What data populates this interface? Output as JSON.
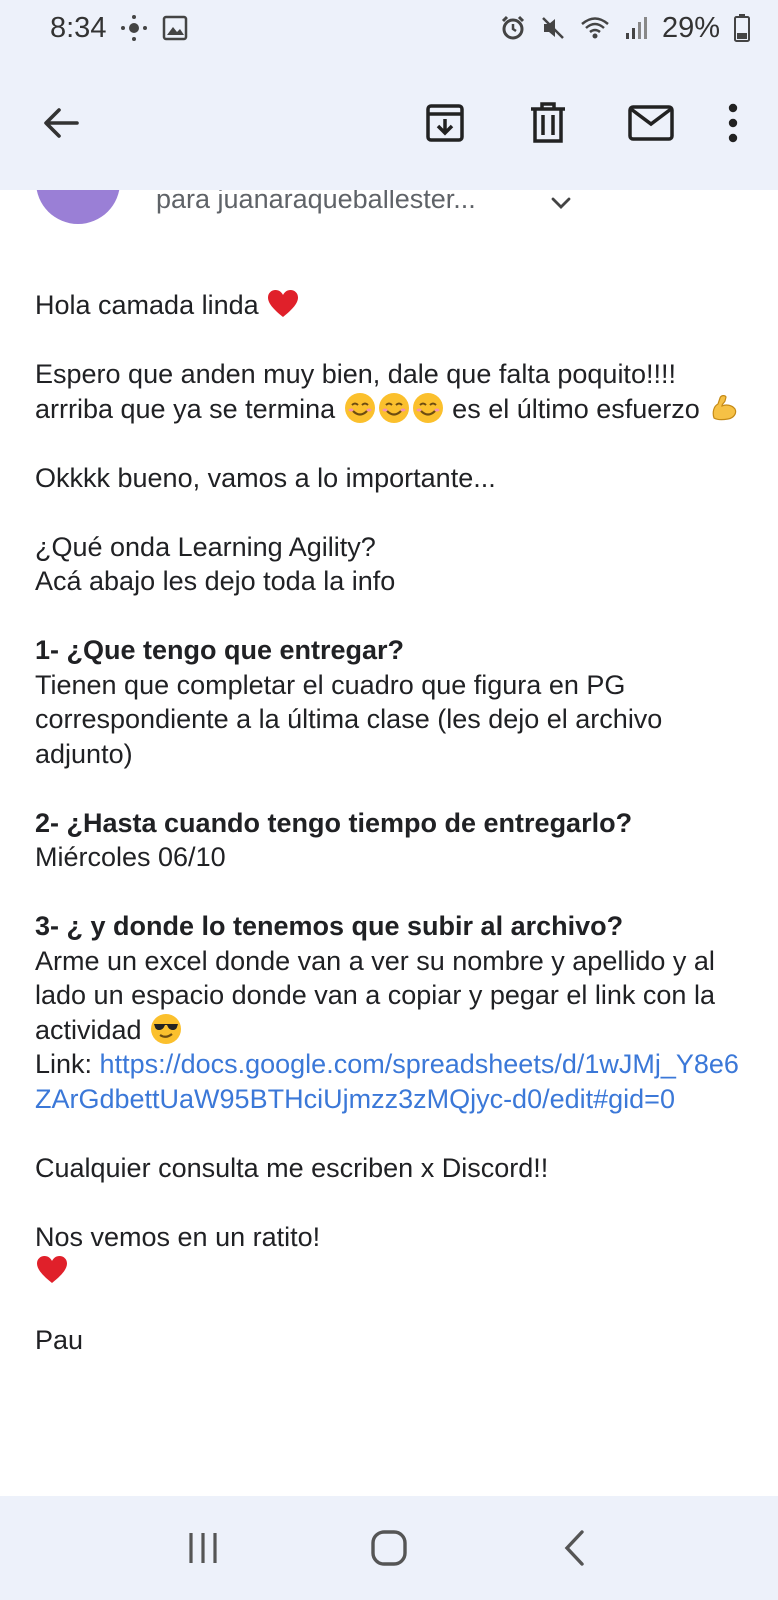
{
  "status_bar": {
    "time": "8:34",
    "battery": "29%",
    "icons": [
      "location-dot-icon",
      "image-icon",
      "alarm-icon",
      "mute-icon",
      "wifi-icon",
      "signal-icon",
      "battery-icon"
    ]
  },
  "app_bar": {
    "back_icon": "arrow-back-icon",
    "actions": [
      "archive-icon",
      "delete-icon",
      "mark-unread-icon",
      "more-vert-icon"
    ]
  },
  "message_header": {
    "recipient": "para juanaraqueballester..."
  },
  "body": {
    "greeting": "Hola camada linda",
    "p1": "Espero que anden muy bien, dale que falta poquito!!!! arrriba que ya se termina",
    "p1_tail": "es el último esfuerzo",
    "p2": "Okkkk bueno, vamos a lo importante...",
    "p3_line1": "¿Qué onda Learning Agility?",
    "p3_line2": "Acá abajo les dejo toda la info",
    "q1_title": "1- ¿Que tengo que entregar?",
    "q1_answer": "Tienen que completar el cuadro que figura en PG correspondiente a la última clase (les dejo el archivo adjunto)",
    "q2_title": "2- ¿Hasta cuando tengo tiempo de entregarlo?",
    "q2_answer": "Miércoles 06/10",
    "q3_title": "3- ¿ y donde lo tenemos que subir al archivo?",
    "q3_answer": "Arme un excel donde van a ver su nombre y apellido y al lado un espacio donde van a copiar y pegar el link con la actividad",
    "link_label": "Link: ",
    "link_text": "https://docs.google.com/spreadsheets/d/1wJMj_Y8e6ZArGdbettUaW95BTHciUjmzz3zMQjyc-d0/edit#gid=0",
    "consult": "Cualquier consulta me escriben x Discord!!",
    "farewell": "Nos vemos en un ratito!",
    "signature": "Pau"
  },
  "colors": {
    "bar_bg": "#edf1fa",
    "link": "#3b78d8",
    "avatar": "#9a7fd6"
  },
  "nav_bar": {
    "buttons": [
      "recent-apps-icon",
      "home-icon",
      "back-nav-icon"
    ]
  }
}
